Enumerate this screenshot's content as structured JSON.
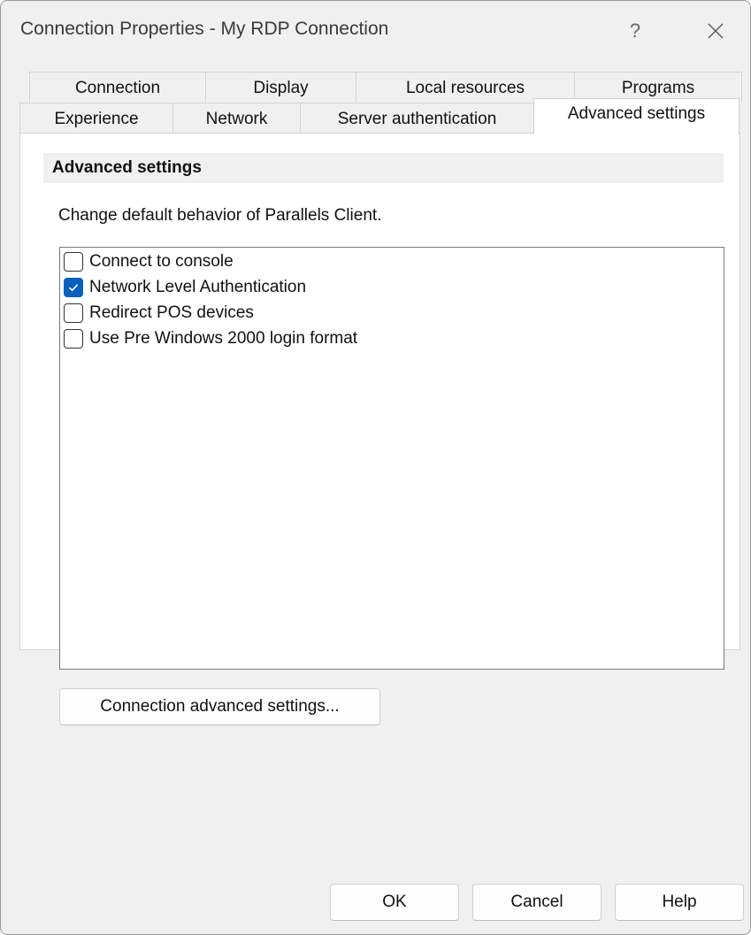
{
  "window": {
    "title": "Connection Properties - My RDP Connection",
    "help_glyph": "?",
    "close_icon": "close-icon"
  },
  "tabs": {
    "row_back": [
      {
        "label": "Connection"
      },
      {
        "label": "Display"
      },
      {
        "label": "Local resources"
      },
      {
        "label": "Programs"
      }
    ],
    "row_front": [
      {
        "label": "Experience"
      },
      {
        "label": "Network"
      },
      {
        "label": "Server authentication"
      },
      {
        "label": "Advanced settings",
        "active": true
      }
    ]
  },
  "panel": {
    "group_title": "Advanced settings",
    "description": "Change default behavior of Parallels Client.",
    "options": [
      {
        "label": "Connect to console",
        "checked": false
      },
      {
        "label": "Network Level Authentication",
        "checked": true
      },
      {
        "label": "Redirect POS devices",
        "checked": false
      },
      {
        "label": "Use Pre Windows 2000 login format",
        "checked": false
      }
    ],
    "advanced_button": "Connection advanced settings..."
  },
  "footer": {
    "ok": "OK",
    "cancel": "Cancel",
    "help": "Help"
  },
  "colors": {
    "accent": "#0b5fbd",
    "window_bg": "#f0f0f0"
  }
}
